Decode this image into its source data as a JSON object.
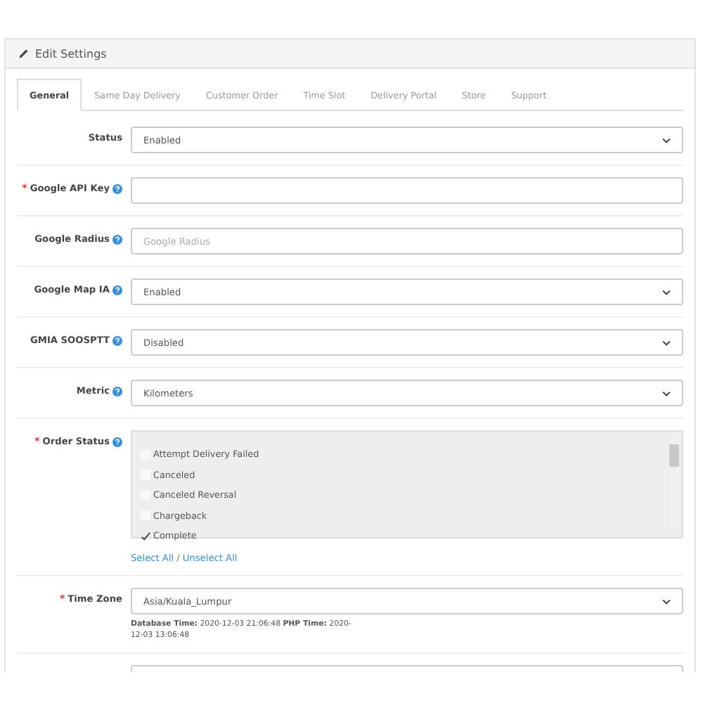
{
  "panel": {
    "title": "Edit Settings"
  },
  "tabs": [
    {
      "label": "General",
      "selected": true
    },
    {
      "label": "Same Day Delivery",
      "selected": false
    },
    {
      "label": "Customer Order",
      "selected": false
    },
    {
      "label": "Time Slot",
      "selected": false
    },
    {
      "label": "Delivery Portal",
      "selected": false
    },
    {
      "label": "Store",
      "selected": false
    },
    {
      "label": "Support",
      "selected": false
    }
  ],
  "fields": [
    {
      "kind": "select",
      "label": "Status",
      "help": false,
      "value": "Enabled"
    },
    {
      "kind": "input",
      "label": "Google API Key",
      "required_mark": "*",
      "help": true
    },
    {
      "kind": "input",
      "label": "Google Radius",
      "help": true,
      "placeholder": "Google Radius"
    },
    {
      "kind": "select",
      "label": "Google Map IA",
      "help": true,
      "value": "Enabled"
    },
    {
      "kind": "select",
      "label": "GMIA SOOSPTT",
      "help": true,
      "value": "Disabled"
    },
    {
      "kind": "select",
      "label": "Metric",
      "help": true,
      "value": "Kilometers"
    },
    {
      "kind": "checklist",
      "label": "Order Status",
      "required_mark": "*",
      "help": true,
      "options": [
        {
          "label": "Attempt Delivery Failed",
          "checked": false
        },
        {
          "label": "Canceled",
          "checked": false
        },
        {
          "label": "Canceled Reversal",
          "checked": false
        },
        {
          "label": "Chargeback",
          "checked": false
        },
        {
          "label": "Complete",
          "checked": true
        }
      ],
      "links": [
        "Select All",
        "Unselect All"
      ],
      "separator": "/"
    },
    {
      "kind": "select",
      "label": "Time Zone",
      "required_mark": "*",
      "help": false,
      "value": "Asia/Kuala_Lumpur",
      "note": "**Database Time:** 2020-12-03 21:06:48 **PHP Time:** 2020-12-03 13:06:48"
    },
    {
      "kind": "input",
      "help": false
    }
  ]
}
